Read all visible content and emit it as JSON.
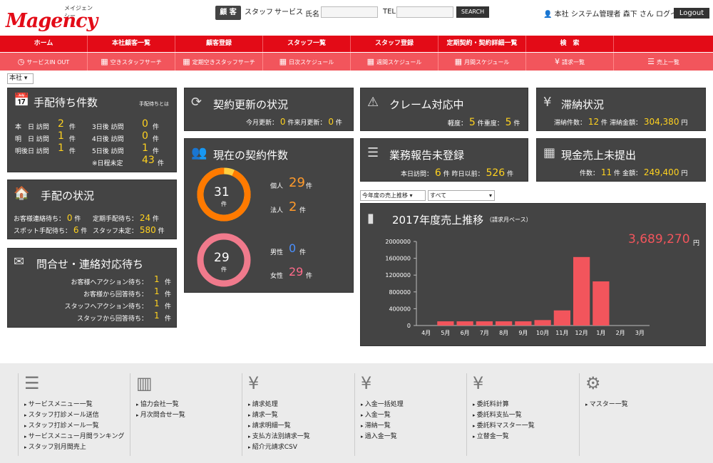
{
  "header": {
    "logo_main": "Magency",
    "logo_sub": "メイジェンシー",
    "segments": [
      "顧 客",
      "スタッフ",
      "サービス"
    ],
    "name_label": "氏名",
    "tel_label": "TEL",
    "search_btn": "SEARCH",
    "user_text": "本社  システム管理者 森下 さん ログイン中",
    "logout": "Logout"
  },
  "nav_main": [
    "ホーム",
    "本社顧客一覧",
    "顧客登録",
    "スタッフ一覧",
    "スタッフ登録",
    "定期契約・契約詳細一覧",
    "検　索",
    ""
  ],
  "nav_sub": [
    {
      "icon": "◷",
      "label": "サービスIN OUT"
    },
    {
      "icon": "▦",
      "label": "空きスタッフサーチ"
    },
    {
      "icon": "▦",
      "label": "定期空きスタッフサーチ"
    },
    {
      "icon": "▦",
      "label": "日次スケジュール"
    },
    {
      "icon": "▦",
      "label": "週間スケジュール"
    },
    {
      "icon": "▦",
      "label": "月間スケジュール"
    },
    {
      "icon": "¥",
      "label": "請求一覧"
    },
    {
      "icon": "☰",
      "label": "売上一覧"
    }
  ],
  "branch_select": "本社",
  "tehai": {
    "title": "手配待ち件数",
    "help": "手配待ちとは",
    "rows_left": [
      {
        "label": "本　日 訪問",
        "value": "2",
        "unit": "件"
      },
      {
        "label": "明　日 訪問",
        "value": "1",
        "unit": "件"
      },
      {
        "label": "明後日 訪問",
        "value": "1",
        "unit": "件"
      }
    ],
    "rows_right": [
      {
        "label": "3日後 訪問",
        "value": "0",
        "unit": "件"
      },
      {
        "label": "4日後 訪問",
        "value": "0",
        "unit": "件"
      },
      {
        "label": "5日後 訪問",
        "value": "1",
        "unit": "件"
      },
      {
        "label": "※日程未定",
        "value": "43",
        "unit": "件"
      }
    ]
  },
  "tehai_status": {
    "title": "手配の状況",
    "l1_label": "お客様連絡待ち：",
    "l1_val": "0",
    "l1_unit": "件",
    "l2_label": "定期手配待ち：",
    "l2_val": "24",
    "l2_unit": "件",
    "l3_label": "スポット手配待ち：",
    "l3_val": "6",
    "l3_unit": "件",
    "l4_label": "スタッフ未定：",
    "l4_val": "580",
    "l4_unit": "件"
  },
  "inquiry": {
    "title": "問合せ・連絡対応待ち",
    "rows": [
      {
        "label": "お客様へアクション待ち：",
        "value": "1",
        "unit": "件"
      },
      {
        "label": "お客様から回答待ち：",
        "value": "1",
        "unit": "件"
      },
      {
        "label": "スタッフへアクション待ち：",
        "value": "1",
        "unit": "件"
      },
      {
        "label": "スタッフから回答待ち：",
        "value": "1",
        "unit": "件"
      }
    ]
  },
  "renewal": {
    "title": "契約更新の状況",
    "this_label": "今月更新：",
    "this_val": "0",
    "this_unit": "件",
    "next_label": "来月更新：",
    "next_val": "0",
    "next_unit": "件"
  },
  "contracts": {
    "title": "現在の契約件数",
    "donut1_value": "31",
    "donut1_unit": "件",
    "donut1_fraction_individual": 0.935,
    "individual_label": "個人",
    "individual_val": "29",
    "individual_unit": "件",
    "corporate_label": "法人",
    "corporate_val": "2",
    "corporate_unit": "件",
    "donut2_value": "29",
    "donut2_unit": "件",
    "male_label": "男性",
    "male_val": "0",
    "male_unit": "件",
    "female_label": "女性",
    "female_val": "29",
    "female_unit": "件",
    "colors": {
      "orange": "#ff7a00",
      "yellow": "#ffcf40",
      "pink": "#f07a8c"
    }
  },
  "claims": {
    "title": "クレーム対応中",
    "light_label": "軽度：",
    "light_val": "5",
    "light_unit": "件",
    "heavy_label": "重度：",
    "heavy_val": "5",
    "heavy_unit": "件"
  },
  "report": {
    "title": "業務報告未登録",
    "today_label": "本日訪問：",
    "today_val": "6",
    "today_unit": "件",
    "before_label": "昨日以前：",
    "before_val": "526",
    "before_unit": "件"
  },
  "overdue": {
    "title": "滞納状況",
    "count_label": "滞納件数：",
    "count_val": "12",
    "count_unit": "件",
    "amount_label": "滞納金額：",
    "amount_val": "304,380",
    "amount_unit": "円"
  },
  "cash": {
    "title": "現金売上未提出",
    "count_label": "件数：",
    "count_val": "11",
    "count_unit": "件",
    "amount_label": "金額：",
    "amount_val": "249,400",
    "amount_unit": "円"
  },
  "sales_controls": {
    "period": "今年度の売上推移",
    "filter": "すべて"
  },
  "sales": {
    "title": "2017年度売上推移",
    "subtitle": "（請求月ベース）",
    "total": "3,689,270",
    "total_unit": "円"
  },
  "chart_data": {
    "type": "bar",
    "categories": [
      "4月",
      "5月",
      "6月",
      "7月",
      "8月",
      "9月",
      "10月",
      "11月",
      "12月",
      "1月",
      "2月",
      "3月"
    ],
    "values": [
      0,
      100000,
      100000,
      100000,
      100000,
      100000,
      130000,
      360000,
      1630000,
      1050000,
      0,
      0
    ],
    "ylim": [
      0,
      2000000
    ],
    "yticks": [
      "0",
      "400000",
      "800000",
      "1200000",
      "1600000",
      "2000000"
    ],
    "ytick_values": [
      0,
      400000,
      800000,
      1200000,
      1600000,
      2000000
    ],
    "bar_color": "#f2555c",
    "grid": false
  },
  "footer": {
    "col1": {
      "icon": "☰",
      "links": [
        "サービスメニュー一覧",
        "スタッフ打診メール送信",
        "スタッフ打診メール一覧",
        "サービスメニュー月間ランキング",
        "スタッフ別月間売上"
      ]
    },
    "col2": {
      "icon": "▥",
      "links": [
        "協力会社一覧",
        "月次問合せ一覧"
      ]
    },
    "col3": {
      "icon": "¥",
      "links": [
        "請求処理",
        "請求一覧",
        "請求明細一覧",
        "支払方法別請求一覧",
        "紹介元請求CSV"
      ]
    },
    "col4": {
      "icon": "¥",
      "links": [
        "入金一括処理",
        "入金一覧",
        "滞納一覧",
        "過入金一覧"
      ]
    },
    "col5": {
      "icon": "¥",
      "links": [
        "委託料計算",
        "委託料支払一覧",
        "委託料マスター一覧",
        "立替金一覧"
      ]
    },
    "col6": {
      "icon": "⚙",
      "links": [
        "マスター一覧"
      ]
    }
  }
}
